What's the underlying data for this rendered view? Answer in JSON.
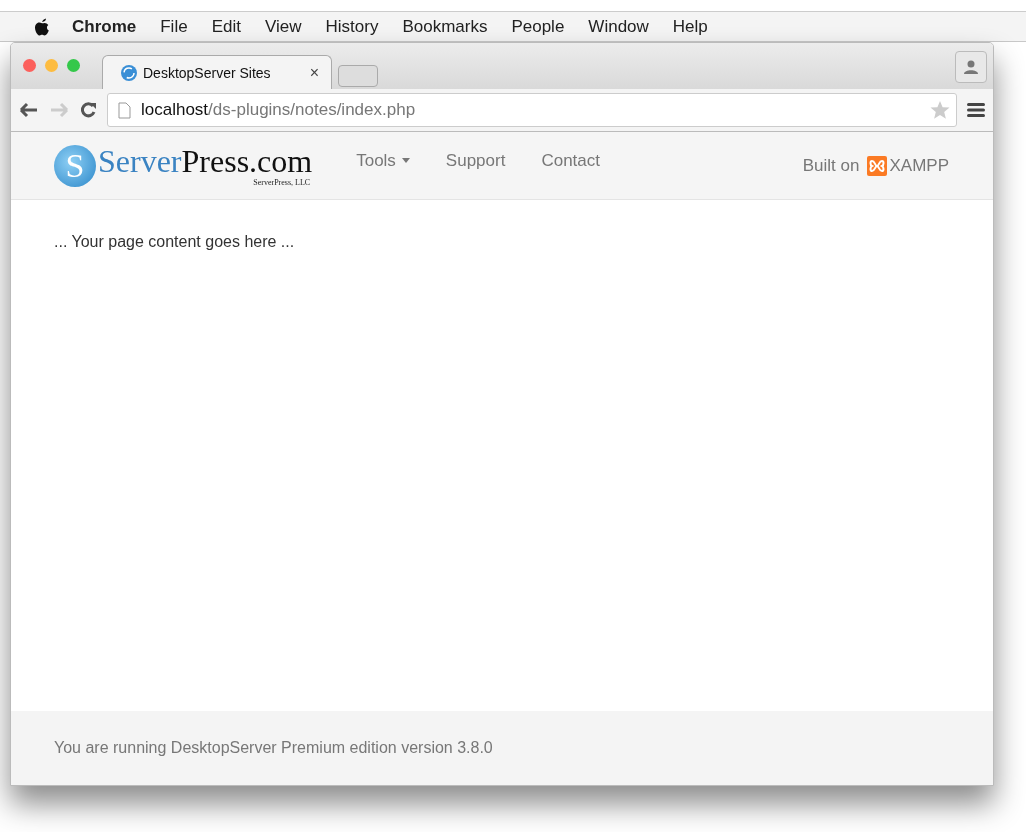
{
  "menu_bar": [
    {
      "label": "Chrome",
      "kind": "app"
    },
    {
      "label": "File",
      "kind": "menu"
    },
    {
      "label": "Edit",
      "kind": "menu"
    },
    {
      "label": "View",
      "kind": "menu"
    },
    {
      "label": "History",
      "kind": "menu"
    },
    {
      "label": "Bookmarks",
      "kind": "menu"
    },
    {
      "label": "People",
      "kind": "menu"
    },
    {
      "label": "Window",
      "kind": "menu"
    },
    {
      "label": "Help",
      "kind": "menu"
    }
  ],
  "tabs": [
    {
      "title": "DesktopServer Sites",
      "close": "×",
      "selected": true
    }
  ],
  "address_bar": {
    "host": "localhost",
    "path": "/ds-plugins/notes/index.php"
  },
  "site_nav": {
    "logo": {
      "mark": "S",
      "first": "Server",
      "second": "Press.com",
      "tagline": "ServerPress, LLC"
    },
    "items": [
      {
        "label": "Tools",
        "dropdown": true
      },
      {
        "label": "Support",
        "dropdown": false
      },
      {
        "label": "Contact",
        "dropdown": false
      }
    ],
    "built_on": {
      "label": "Built on",
      "product": "XAMPP"
    }
  },
  "content": {
    "text": "... Your page content goes here ..."
  },
  "footer": {
    "text": "You are running DesktopServer Premium edition version 3.8.0"
  }
}
